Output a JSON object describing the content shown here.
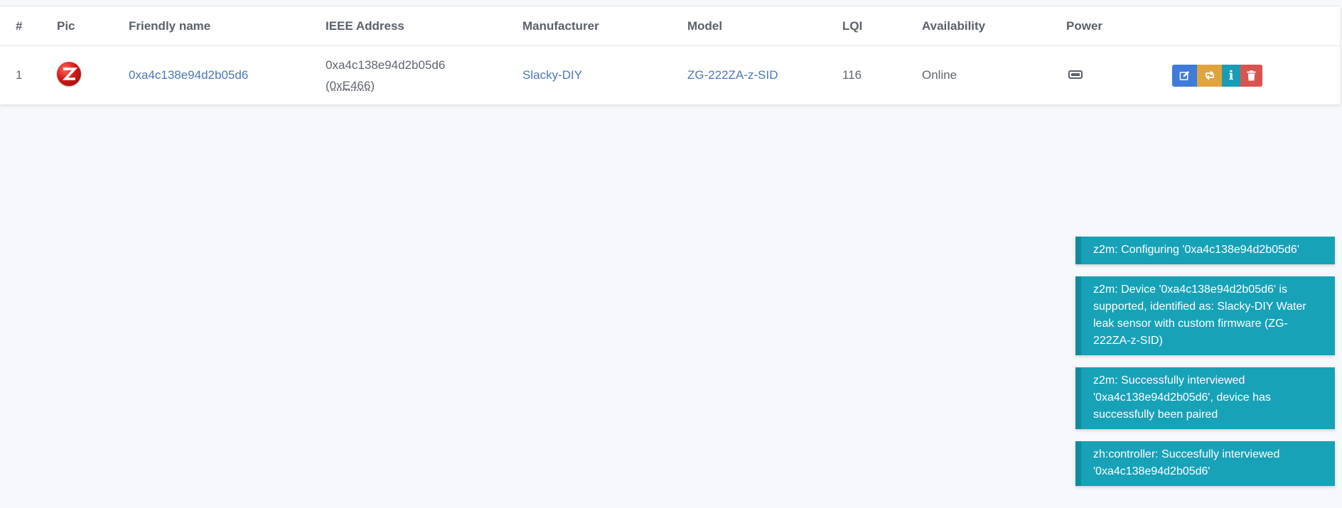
{
  "table": {
    "headers": {
      "num": "#",
      "pic": "Pic",
      "friendly_name": "Friendly name",
      "ieee": "IEEE Address",
      "manufacturer": "Manufacturer",
      "model": "Model",
      "lqi": "LQI",
      "availability": "Availability",
      "power": "Power"
    },
    "rows": [
      {
        "num": "1",
        "pic_icon": "zigbee-logo-icon",
        "friendly_name": "0xa4c138e94d2b05d6",
        "ieee": "0xa4c138e94d2b05d6",
        "nwk": "(0xE466)",
        "manufacturer": "Slacky-DIY",
        "model": "ZG-222ZA-z-SID",
        "lqi": "116",
        "availability": "Online",
        "power_icon": "battery-icon"
      }
    ]
  },
  "actions": {
    "edit_icon": "edit-icon",
    "configure_icon": "reconfigure-icon",
    "info_icon": "info-icon",
    "info_glyph": "i",
    "delete_icon": "trash-icon"
  },
  "colors": {
    "toast_bg": "#17a2b8",
    "edit": "#3f7bd8",
    "configure": "#e0a43f",
    "info": "#1b9cb5",
    "delete": "#d9534f",
    "link": "#4a78b8"
  },
  "toasts": [
    {
      "text": "z2m: Configuring '0xa4c138e94d2b05d6'"
    },
    {
      "text": "z2m: Device '0xa4c138e94d2b05d6' is supported, identified as: Slacky-DIY Water leak sensor with custom firmware (ZG-222ZA-z-SID)"
    },
    {
      "text": "z2m: Successfully interviewed '0xa4c138e94d2b05d6', device has successfully been paired"
    },
    {
      "text": "zh:controller: Succesfully interviewed '0xa4c138e94d2b05d6'"
    }
  ]
}
